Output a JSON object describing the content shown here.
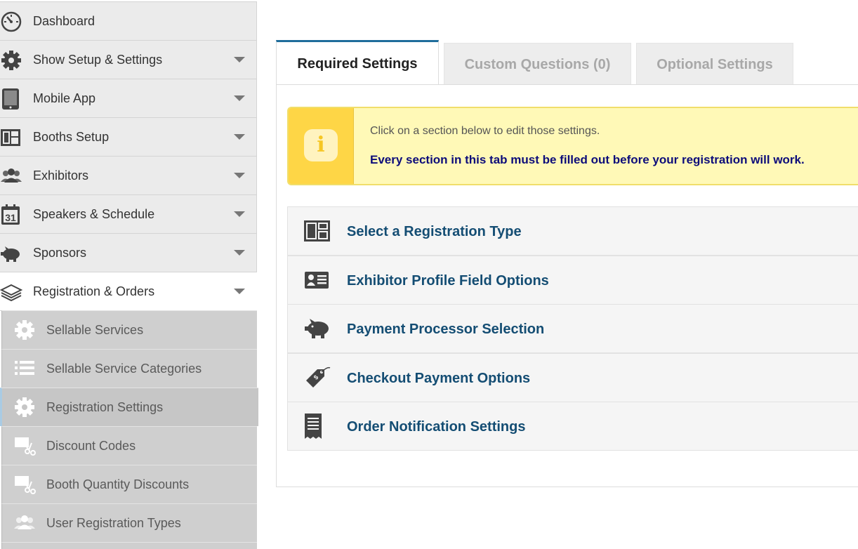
{
  "sidebar": {
    "items": [
      {
        "label": "Dashboard",
        "icon": "dashboard-icon"
      },
      {
        "label": "Show Setup & Settings",
        "icon": "gear-icon"
      },
      {
        "label": "Mobile App",
        "icon": "tablet-icon"
      },
      {
        "label": "Booths Setup",
        "icon": "layout-icon"
      },
      {
        "label": "Exhibitors",
        "icon": "users-icon"
      },
      {
        "label": "Speakers & Schedule",
        "icon": "calendar-icon",
        "calendar_day": "31"
      },
      {
        "label": "Sponsors",
        "icon": "piggy-bank-icon"
      },
      {
        "label": "Registration & Orders",
        "icon": "layers-icon"
      }
    ],
    "subitems": [
      {
        "label": "Sellable Services",
        "icon": "gear-icon"
      },
      {
        "label": "Sellable Service Categories",
        "icon": "list-icon"
      },
      {
        "label": "Registration Settings",
        "icon": "gear-icon"
      },
      {
        "label": "Discount Codes",
        "icon": "coupon-scissors-icon"
      },
      {
        "label": "Booth Quantity Discounts",
        "icon": "coupon-scissors-icon"
      },
      {
        "label": "User Registration Types",
        "icon": "users-icon"
      }
    ]
  },
  "tabs": [
    {
      "label": "Required Settings",
      "active": true
    },
    {
      "label": "Custom Questions (0)",
      "active": false
    },
    {
      "label": "Optional Settings",
      "active": false
    }
  ],
  "info": {
    "icon": "info-icon",
    "icon_glyph": "i",
    "message": "Click on a section below to edit those settings.",
    "warning": "Every section in this tab must be filled out before your registration will work."
  },
  "sections": [
    {
      "label": "Select a Registration Type",
      "icon": "layout-icon"
    },
    {
      "label": "Exhibitor Profile Field Options",
      "icon": "id-card-icon"
    },
    {
      "label": "Payment Processor Selection",
      "icon": "piggy-bank-icon"
    },
    {
      "label": "Checkout Payment Options",
      "icon": "price-tag-icon"
    },
    {
      "label": "Order Notification Settings",
      "icon": "receipt-icon"
    }
  ],
  "colors": {
    "accent": "#1f6d9b",
    "section_text": "#144d73",
    "warning_text": "#0d0d7a",
    "info_bg": "#fff9b7",
    "info_side": "#fed646"
  }
}
